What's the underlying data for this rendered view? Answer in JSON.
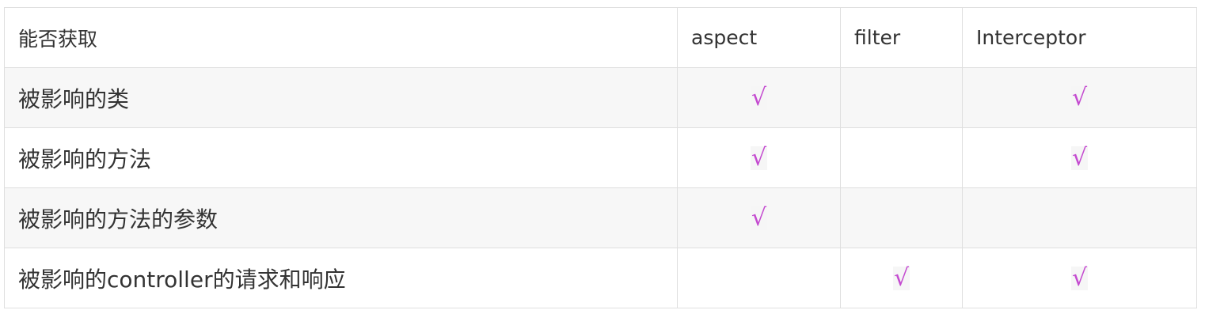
{
  "header": [
    "能否获取",
    "aspect",
    "filter",
    "Interceptor"
  ],
  "check_mark": "√",
  "rows": [
    {
      "label": "被影响的类",
      "aspect": true,
      "filter": false,
      "interceptor": true
    },
    {
      "label": "被影响的方法",
      "aspect": true,
      "filter": false,
      "interceptor": true
    },
    {
      "label": "被影响的方法的参数",
      "aspect": true,
      "filter": false,
      "interceptor": false
    },
    {
      "label": "被影响的controller的请求和响应",
      "aspect": false,
      "filter": true,
      "interceptor": true
    }
  ],
  "colors": {
    "check": "#c44bd0",
    "border": "#dfdfdf",
    "alt_row": "#f7f7f7",
    "text": "#333333"
  }
}
